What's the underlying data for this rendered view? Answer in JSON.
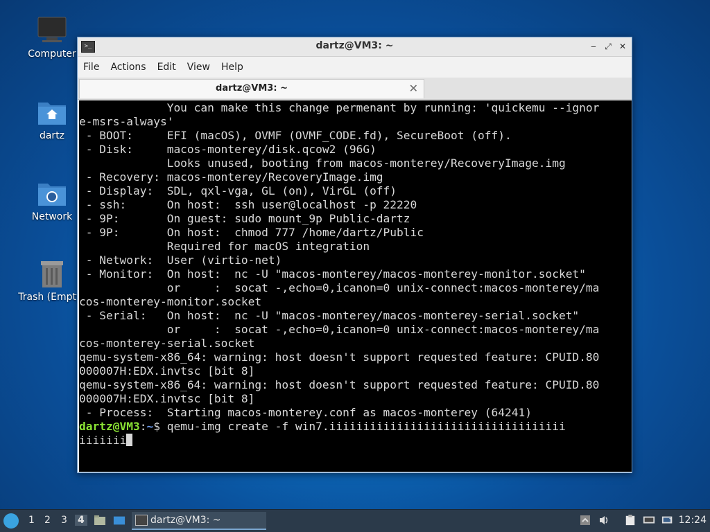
{
  "desktop": {
    "icons": [
      {
        "label": "Computer"
      },
      {
        "label": "dartz"
      },
      {
        "label": "Network"
      },
      {
        "label": "Trash (Empty)"
      }
    ]
  },
  "window": {
    "title": "dartz@VM3: ~",
    "controls": {
      "minimize": "‒",
      "maximize": "⤢",
      "close": "✕"
    },
    "menu": [
      "File",
      "Actions",
      "Edit",
      "View",
      "Help"
    ],
    "tab": {
      "title": "dartz@VM3: ~",
      "close": "✕"
    }
  },
  "terminal": {
    "lines": [
      "             You can make this change permenant by running: 'quickemu --ignor",
      "e-msrs-always'",
      " - BOOT:     EFI (macOS), OVMF (OVMF_CODE.fd), SecureBoot (off).",
      " - Disk:     macos-monterey/disk.qcow2 (96G)",
      "             Looks unused, booting from macos-monterey/RecoveryImage.img",
      " - Recovery: macos-monterey/RecoveryImage.img",
      " - Display:  SDL, qxl-vga, GL (on), VirGL (off)",
      " - ssh:      On host:  ssh user@localhost -p 22220",
      " - 9P:       On guest: sudo mount_9p Public-dartz",
      " - 9P:       On host:  chmod 777 /home/dartz/Public",
      "             Required for macOS integration",
      " - Network:  User (virtio-net)",
      " - Monitor:  On host:  nc -U \"macos-monterey/macos-monterey-monitor.socket\"",
      "             or     :  socat -,echo=0,icanon=0 unix-connect:macos-monterey/ma",
      "cos-monterey-monitor.socket",
      " - Serial:   On host:  nc -U \"macos-monterey/macos-monterey-serial.socket\"",
      "             or     :  socat -,echo=0,icanon=0 unix-connect:macos-monterey/ma",
      "cos-monterey-serial.socket",
      "qemu-system-x86_64: warning: host doesn't support requested feature: CPUID.80",
      "000007H:EDX.invtsc [bit 8]",
      "qemu-system-x86_64: warning: host doesn't support requested feature: CPUID.80",
      "000007H:EDX.invtsc [bit 8]",
      " - Process:  Starting macos-monterey.conf as macos-monterey (64241)"
    ],
    "prompt": {
      "user": "dartz@VM3",
      "sep": ":",
      "path": "~",
      "dollar": "$ ",
      "command": "qemu-img create -f win7.iiiiiiiiiiiiiiiiiiiiiiiiiiiiiiiiiii",
      "continuation": "iiiiiii"
    }
  },
  "taskbar": {
    "workspaces": [
      "1",
      "2",
      "3",
      "4"
    ],
    "active_workspace": "4",
    "task_title": "dartz@VM3: ~",
    "clock": "12:24"
  }
}
